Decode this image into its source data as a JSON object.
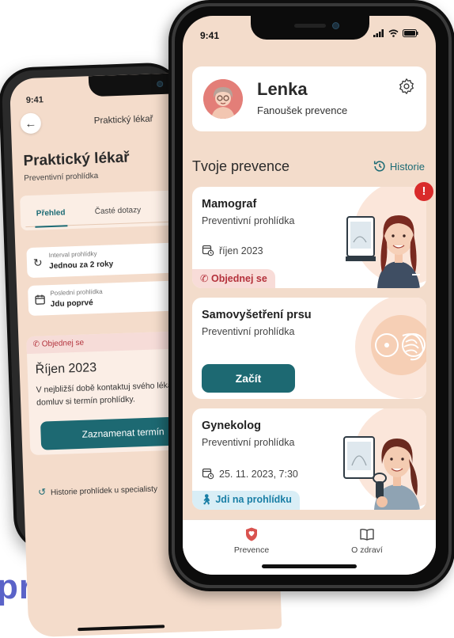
{
  "headline": "pro ženy",
  "back_screen": {
    "status_time": "9:41",
    "nav_title": "Praktický lékař",
    "title": "Praktický lékař",
    "subtitle": "Preventivní prohlídka",
    "tabs": [
      {
        "label": "Přehled",
        "active": true
      },
      {
        "label": "Časté dotazy",
        "active": false
      }
    ],
    "interval": {
      "label": "Interval prohlídky",
      "value": "Jednou za 2 roky",
      "icon": "refresh-icon"
    },
    "last_visit": {
      "label": "Poslední prohlídka",
      "value": "Jdu poprvé",
      "icon": "calendar-icon"
    },
    "order_badge": "Objednej se",
    "order_month": "Říjen 2023",
    "order_text": "V nejbližší době kontaktuj svého lékaře a domluv si termín prohlídky.",
    "order_button": "Zaznamenat termín",
    "history_link": "Historie prohlídek u specialisty"
  },
  "front_screen": {
    "status_time": "9:41",
    "status_icons": "signal wifi battery",
    "profile": {
      "name": "Lenka",
      "role": "Fanoušek prevence",
      "settings_icon": "gear-icon"
    },
    "section_title": "Tvoje prevence",
    "history_link": "Historie",
    "cards": [
      {
        "title": "Mamograf",
        "subtitle": "Preventivní prohlídka",
        "date": "říjen 2023",
        "tag": "Objednej se",
        "tag_type": "red",
        "alert": "!"
      },
      {
        "title": "Samovyšetření prsu",
        "subtitle": "Preventivní prohlídka",
        "button": "Začít"
      },
      {
        "title": "Gynekolog",
        "subtitle": "Preventivní prohlídka",
        "date": "25. 11. 2023, 7:30",
        "tag": "Jdi na prohlídku",
        "tag_type": "blue"
      }
    ],
    "tabbar": [
      {
        "label": "Prevence",
        "icon": "shield-icon",
        "active": true
      },
      {
        "label": "O zdraví",
        "icon": "book-icon",
        "active": false
      }
    ]
  },
  "colors": {
    "accent": "#1d6972",
    "background": "#f3dccb",
    "alert": "#d92b2b",
    "headline": "#5a63c8"
  }
}
